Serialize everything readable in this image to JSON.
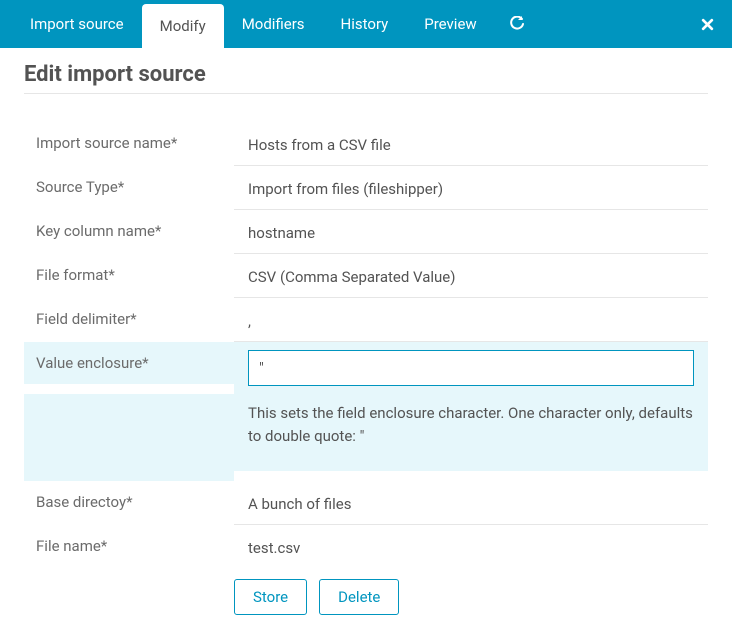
{
  "tabs": {
    "import_source": "Import source",
    "modify": "Modify",
    "modifiers": "Modifiers",
    "history": "History",
    "preview": "Preview"
  },
  "heading": "Edit import source",
  "form": {
    "import_source_name": {
      "label": "Import source name*",
      "value": "Hosts from a CSV file"
    },
    "source_type": {
      "label": "Source Type*",
      "value": "Import from files (fileshipper)"
    },
    "key_column_name": {
      "label": "Key column name*",
      "value": "hostname"
    },
    "file_format": {
      "label": "File format*",
      "value": "CSV (Comma Separated Value)"
    },
    "field_delimiter": {
      "label": "Field delimiter*",
      "value": ","
    },
    "value_enclosure": {
      "label": "Value enclosure*",
      "value": "\"",
      "help": "This sets the field enclosure character. One character only, defaults to double quote: \""
    },
    "base_directory": {
      "label": "Base directoy*",
      "value": "A bunch of files"
    },
    "file_name": {
      "label": "File name*",
      "value": "test.csv"
    }
  },
  "buttons": {
    "store": "Store",
    "delete": "Delete"
  }
}
